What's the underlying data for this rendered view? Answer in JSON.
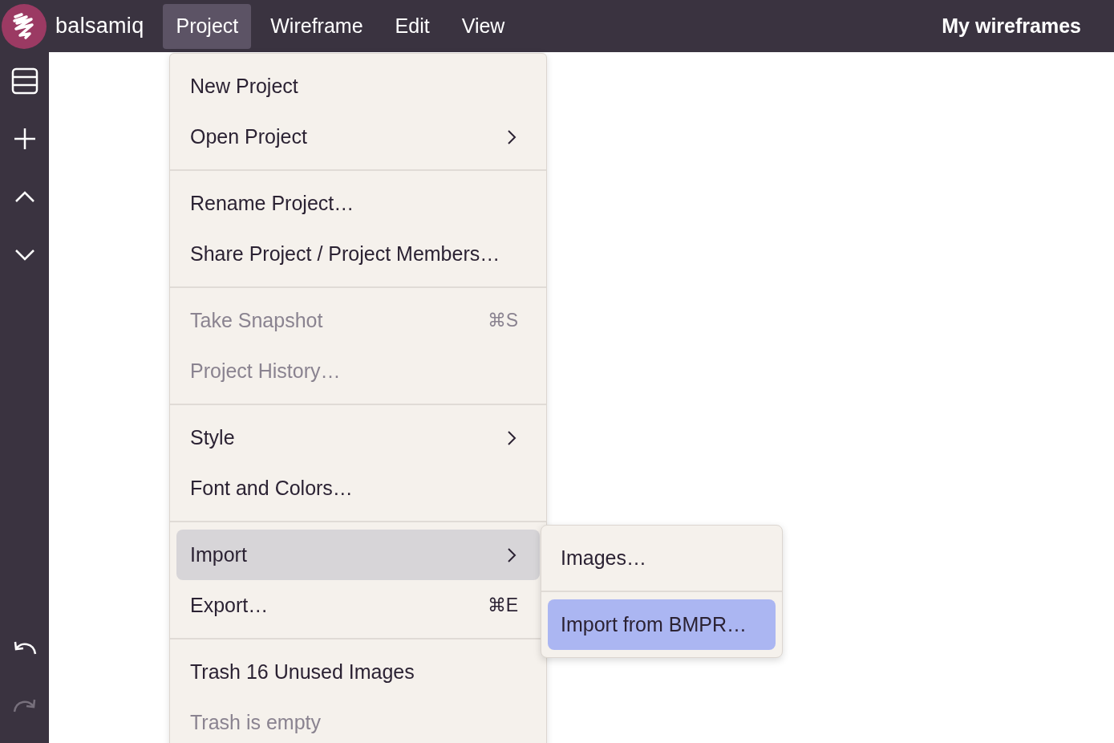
{
  "app": {
    "brand": "balsamiq"
  },
  "menubar": [
    {
      "label": "Project",
      "selected": true
    },
    {
      "label": "Wireframe",
      "selected": false
    },
    {
      "label": "Edit",
      "selected": false
    },
    {
      "label": "View",
      "selected": false
    }
  ],
  "right_link": "My wireframes",
  "sidebar": {
    "top_tools": [
      {
        "kind": "panel"
      },
      {
        "kind": "add"
      },
      {
        "kind": "up"
      },
      {
        "kind": "down"
      }
    ],
    "bottom_tools": [
      {
        "kind": "undo",
        "disabled": false
      },
      {
        "kind": "redo",
        "disabled": true
      }
    ]
  },
  "menu": {
    "groups": [
      [
        {
          "label": "New Project",
          "disabled": false,
          "submenu": false,
          "selected": false
        },
        {
          "label": "Open Project",
          "disabled": false,
          "submenu": true,
          "selected": false
        }
      ],
      [
        {
          "label": "Rename Project…",
          "disabled": false,
          "submenu": false,
          "selected": false
        },
        {
          "label": "Share Project / Project Members…",
          "disabled": false,
          "submenu": false,
          "selected": false
        }
      ],
      [
        {
          "label": "Take Snapshot",
          "shortcut": "⌘S",
          "disabled": true,
          "submenu": false,
          "selected": false
        },
        {
          "label": "Project History…",
          "disabled": true,
          "submenu": false,
          "selected": false
        }
      ],
      [
        {
          "label": "Style",
          "disabled": false,
          "submenu": true,
          "selected": false
        },
        {
          "label": "Font and Colors…",
          "disabled": false,
          "submenu": false,
          "selected": false
        }
      ],
      [
        {
          "label": "Import",
          "disabled": false,
          "submenu": true,
          "selected": true
        },
        {
          "label": "Export…",
          "shortcut": "⌘E",
          "disabled": false,
          "submenu": false,
          "selected": false
        }
      ],
      [
        {
          "label": "Trash 16 Unused Images",
          "disabled": false,
          "submenu": false,
          "selected": false
        },
        {
          "label": "Trash is empty",
          "disabled": true,
          "submenu": false,
          "selected": false
        }
      ]
    ]
  },
  "submenu": {
    "groups": [
      [
        {
          "label": "Images…",
          "selected": false
        }
      ],
      [
        {
          "label": "Import from BMPR…",
          "selected": true
        }
      ]
    ]
  }
}
